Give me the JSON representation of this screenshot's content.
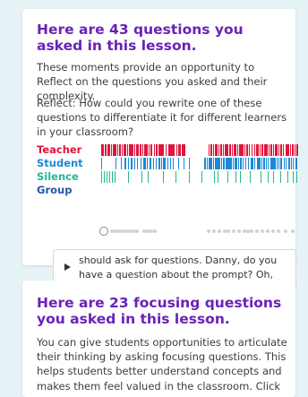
{
  "card1": {
    "title": "Here are 43 questions you asked in this lesson.",
    "description": "These moments provide an opportunity to Reflect on the questions you asked and their complexity.",
    "reflect": "Reflect: How could you rewrite one of these questions to differentiate it for different learners in your classroom?",
    "timeline": {
      "rows": [
        {
          "label": "Teacher",
          "color": "#e0143c"
        },
        {
          "label": "Student",
          "color": "#1c88d6"
        },
        {
          "label": "Silence",
          "color": "#22b894"
        },
        {
          "label": "Group",
          "color": "#2358a8"
        }
      ],
      "progress": 0
    },
    "snippet": "should ask for questions. Danny, do you have a question about the prompt? Oh, no. Alright. L..."
  },
  "card2": {
    "title": "Here are 23 focusing questions you asked in this lesson.",
    "description": "You can give students opportunities to articulate their thinking by asking focusing questions. This helps students better understand concepts and makes them feel valued in the classroom. Click"
  },
  "colors": {
    "page_background": "#e6f3f6",
    "title": "#6a22b8"
  }
}
